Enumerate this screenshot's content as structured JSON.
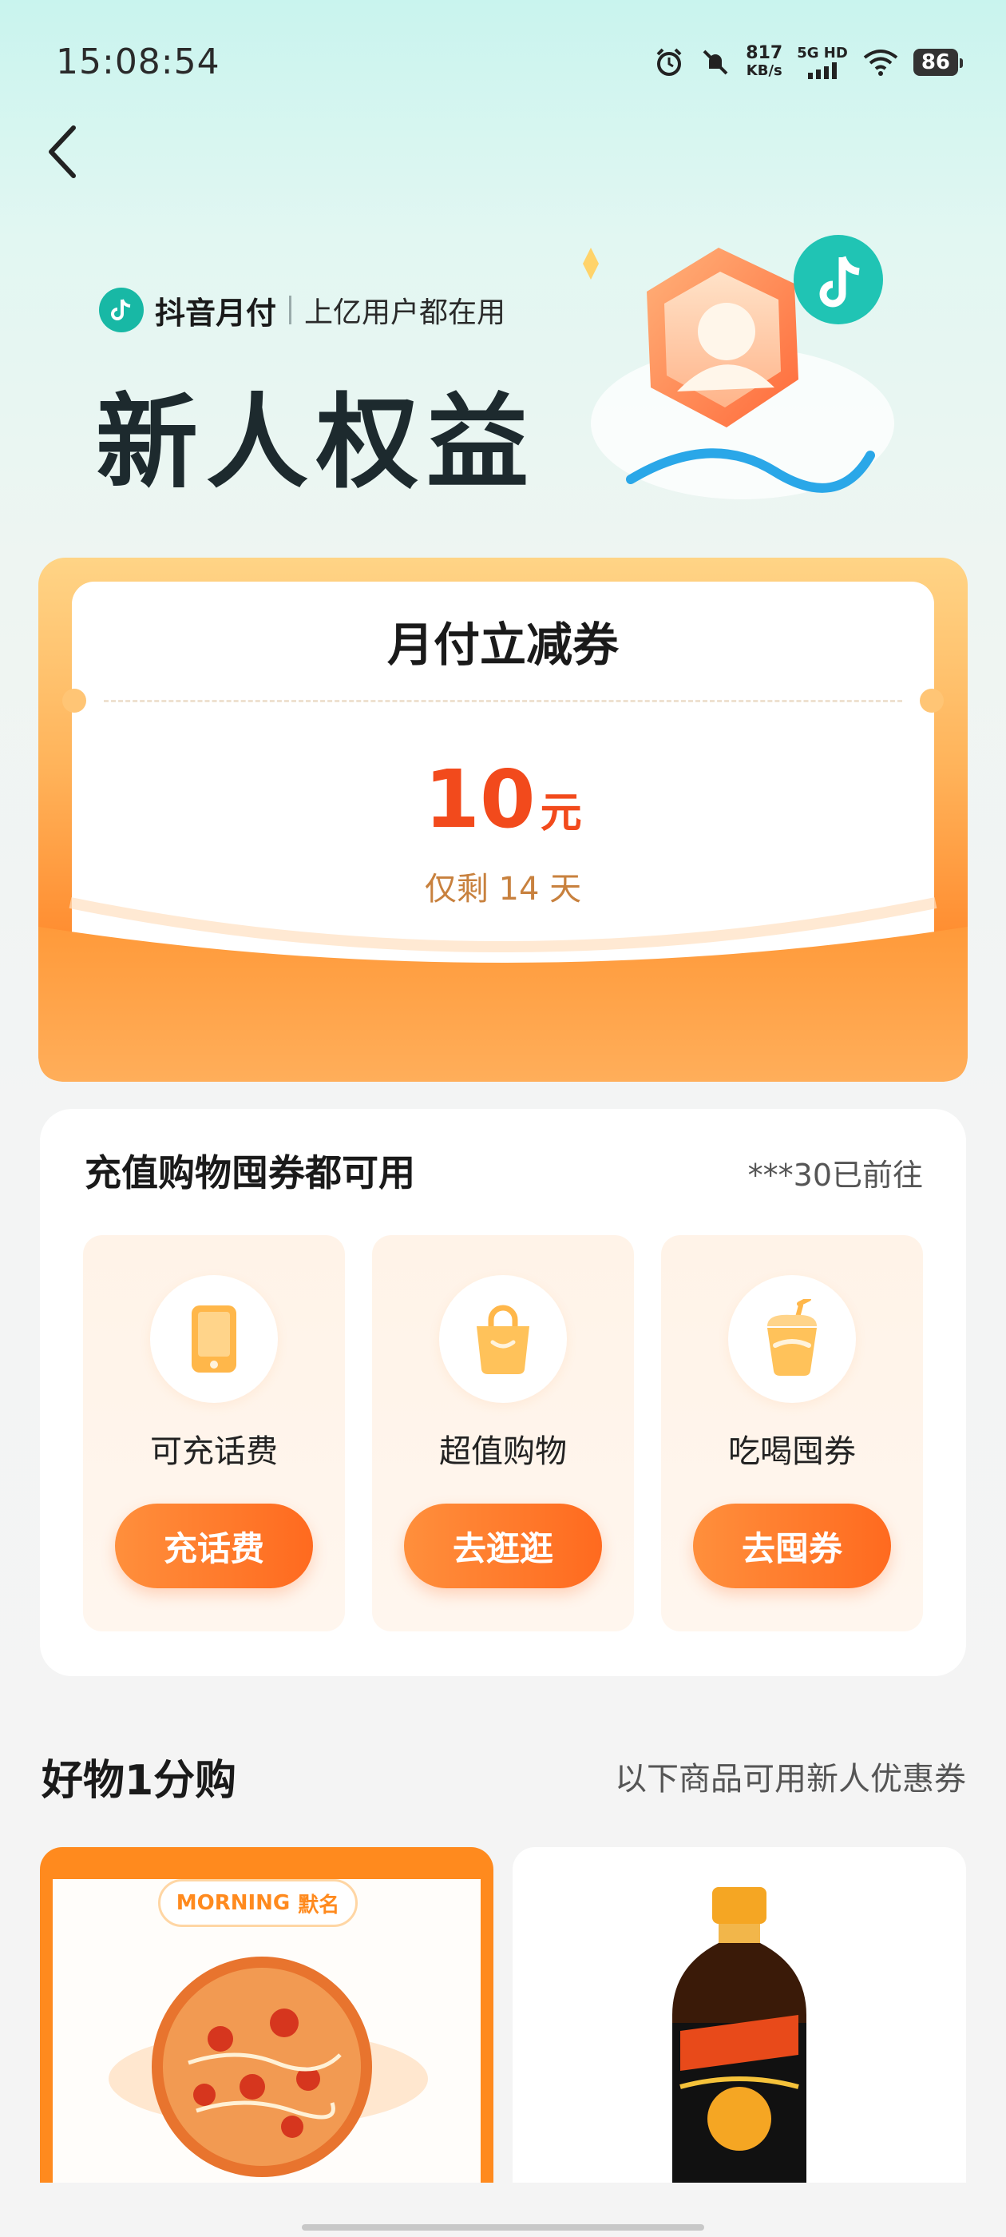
{
  "status_bar": {
    "time": "15:08:54",
    "speed_value": "817",
    "speed_unit": "KB/s",
    "network": "5G HD",
    "battery": "86",
    "icons": [
      "alarm-icon",
      "mute-icon",
      "signal-icon",
      "wifi-icon",
      "battery-icon"
    ]
  },
  "header": {
    "brand_name": "抖音月付",
    "brand_slogan": "上亿用户都在用",
    "title": "新人权益"
  },
  "coupon": {
    "title": "月付立减券",
    "amount": "10",
    "unit": "元",
    "remain": "仅剩 14 天"
  },
  "categories": {
    "title": "充值购物囤券都可用",
    "right_text": "***30已前往",
    "items": [
      {
        "label": "可充话费",
        "button": "充话费",
        "icon": "phone-icon"
      },
      {
        "label": "超值购物",
        "button": "去逛逛",
        "icon": "shopping-bag-icon"
      },
      {
        "label": "吃喝囤券",
        "button": "去囤券",
        "icon": "drink-cup-icon"
      }
    ]
  },
  "products": {
    "title": "好物1分购",
    "right_text": "以下商品可用新人优惠券",
    "brand_badge_en": "MORNING",
    "brand_badge_cn": "默名"
  },
  "colors": {
    "accent": "#ff6a1f",
    "brand_teal": "#18b8a5",
    "coupon_red": "#f24a1c"
  }
}
